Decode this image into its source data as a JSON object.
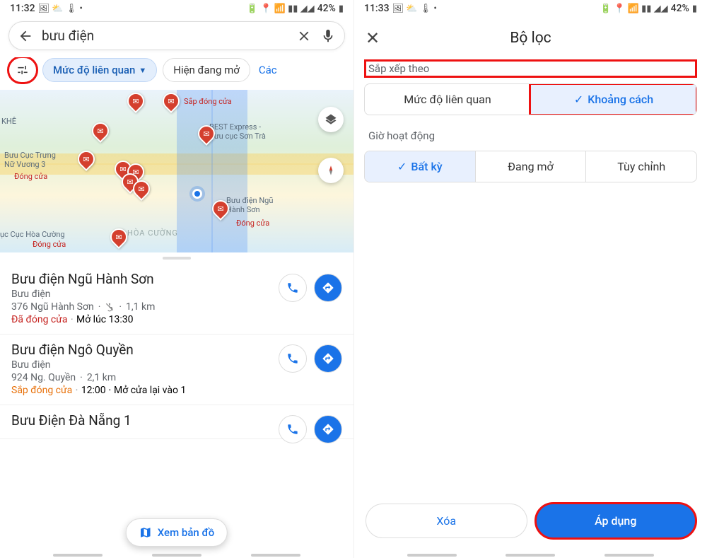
{
  "statusbar": {
    "time_a": "11:32",
    "time_b": "11:33",
    "battery": "42%"
  },
  "search": {
    "query": "bưu điện"
  },
  "chips": {
    "relevance": "Mức độ liên quan",
    "open_now": "Hiện đang mở",
    "more": "Các"
  },
  "map": {
    "labels": {
      "khe": "KHÊ",
      "best": "BEST Express -\nBưu cục Sơn Trà",
      "closing": "Sắp đóng cửa",
      "trung": "Bưu Cục Trưng\nNữ Vương 3",
      "trung_status": "Đóng cửa",
      "ngu_hs": "Bưu điện Ngũ\nHành Sơn",
      "ngu_hs_status": "Đóng cửa",
      "hoacuong": "ục Cục Hòa Cường",
      "hoacuong_status": "Đóng cửa",
      "district": "HÒA CƯỜNG"
    }
  },
  "results": [
    {
      "name": "Bưu điện Ngũ Hành Sơn",
      "type": "Bưu điện",
      "addr": "376 Ngũ Hành Sơn",
      "dist": "1,1 km",
      "status": "Đã đóng cửa",
      "reopen": "Mở lúc 13:30",
      "status_kind": "closed"
    },
    {
      "name": "Bưu điện Ngô Quyền",
      "type": "Bưu điện",
      "addr": "924 Ng. Quyền",
      "dist": "2,1 km",
      "status": "Sắp đóng cửa",
      "extra": "12:00 ⋅ Mở cửa lại vào 1",
      "status_kind": "closing"
    },
    {
      "name": "Bưu Điện Đà Nẵng 1"
    }
  ],
  "fab_map": "Xem bản đồ",
  "filters": {
    "title": "Bộ lọc",
    "sort_by": "Sắp xếp theo",
    "sort_relevance": "Mức độ liên quan",
    "sort_distance": "Khoảng cách",
    "hours": "Giờ hoạt động",
    "hours_any": "Bất kỳ",
    "hours_open": "Đang mở",
    "hours_custom": "Tùy chỉnh",
    "clear": "Xóa",
    "apply": "Áp dụng"
  }
}
